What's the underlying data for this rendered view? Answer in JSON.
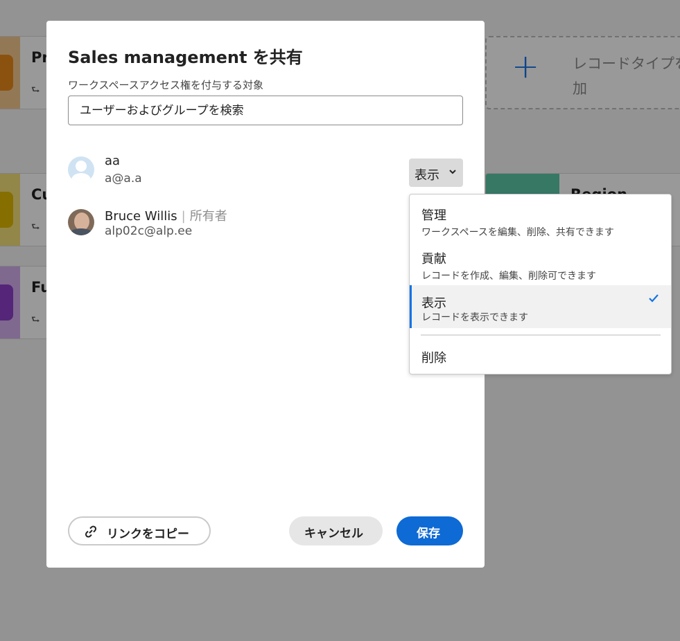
{
  "background": {
    "cards": [
      {
        "title": "Pr",
        "subtitle": "⮑",
        "color": "#f0a040"
      },
      {
        "title": "Cu",
        "subtitle": "⮑",
        "color": "#e8c440"
      },
      {
        "title": "Fu",
        "subtitle": "⮑",
        "color": "#a064c8"
      }
    ],
    "add_record_label": "レコードタイプを追加",
    "region_label": "Region"
  },
  "dialog": {
    "title": "Sales management を共有",
    "access_label": "ワークスペースアクセス権を付与する対象",
    "search_placeholder": "ユーザーおよびグループを検索",
    "users": [
      {
        "name": "aa",
        "email": "a@a.a",
        "avatar": "default-avatar-icon"
      },
      {
        "name": "Bruce Willis",
        "separator": "|",
        "role": "所有者",
        "email": "alp02c@alp.ee",
        "avatar": "user-photo"
      }
    ],
    "permission_button": {
      "label": "表示",
      "icon": "chevron-down-icon"
    },
    "copy_link_label": "リンクをコピー",
    "copy_link_icon": "link-icon",
    "cancel_label": "キャンセル",
    "save_label": "保存"
  },
  "permission_menu": {
    "items": [
      {
        "label": "管理",
        "description": "ワークスペースを編集、削除、共有できます",
        "selected": false
      },
      {
        "label": "貢献",
        "description": "レコードを作成、編集、削除可できます",
        "selected": false
      },
      {
        "label": "表示",
        "description": "レコードを表示できます",
        "selected": true
      }
    ],
    "delete_label": "削除",
    "accent_color": "#1473e6"
  }
}
